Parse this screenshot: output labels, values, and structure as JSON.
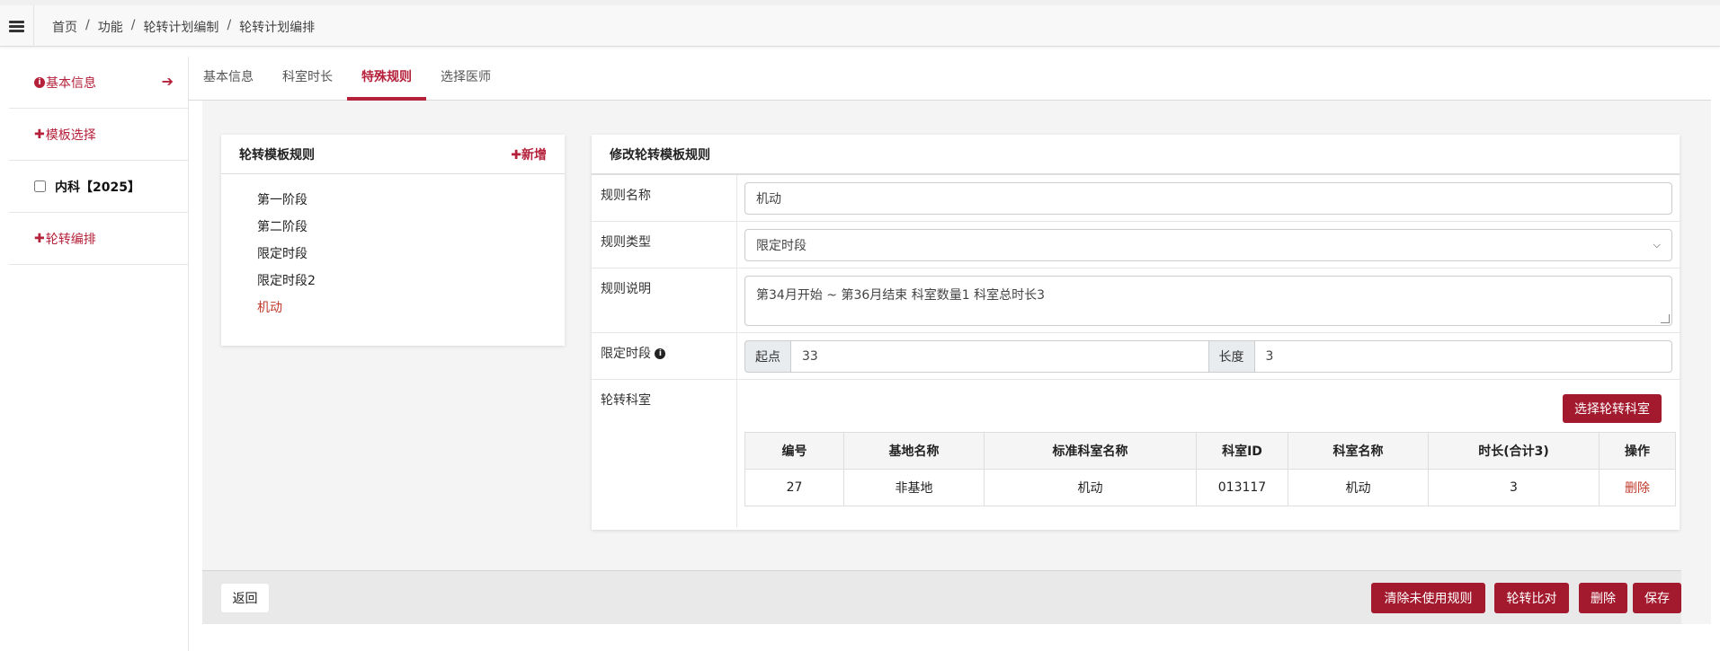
{
  "header": {
    "breadcrumb": [
      "首页",
      "功能",
      "轮转计划编制",
      "轮转计划编排"
    ]
  },
  "sidebar": {
    "items": [
      {
        "icon": "info-circle",
        "label": "基本信息",
        "arrow": "➔"
      },
      {
        "icon": "plus",
        "label": "模板选择"
      },
      {
        "icon": "checkbox",
        "label": "内科【2025】",
        "checked": false
      },
      {
        "icon": "plus",
        "label": "轮转编排"
      }
    ]
  },
  "tabs": [
    {
      "label": "基本信息",
      "active": false
    },
    {
      "label": "科室时长",
      "active": false
    },
    {
      "label": "特殊规则",
      "active": true
    },
    {
      "label": "选择医师",
      "active": false
    }
  ],
  "rules_panel": {
    "title": "轮转模板规则",
    "add_label": "✚新增",
    "items": [
      "第一阶段",
      "第二阶段",
      "限定时段",
      "限定时段2",
      "机动"
    ],
    "active_item": "机动"
  },
  "edit_panel": {
    "title": "修改轮转模板规则",
    "fields": {
      "name_label": "规则名称",
      "name_value": "机动",
      "type_label": "规则类型",
      "type_value": "限定时段",
      "desc_label": "规则说明",
      "desc_value": "第34月开始 ~ 第36月结束 科室数量1 科室总时长3",
      "period_label": "限定时段",
      "start_label": "起点",
      "start_value": "33",
      "length_label": "长度",
      "length_value": "3",
      "dept_label": "轮转科室"
    },
    "select_dept_button": "选择轮转科室",
    "table": {
      "headers": [
        "编号",
        "基地名称",
        "标准科室名称",
        "科室ID",
        "科室名称",
        "时长(合计3)",
        "操作"
      ],
      "rows": [
        {
          "id": "27",
          "base": "非基地",
          "std_dept": "机动",
          "dept_id": "013117",
          "dept_name": "机动",
          "duration": "3",
          "action": "删除"
        }
      ]
    }
  },
  "footer": {
    "back": "返回",
    "clear_unused": "清除未使用规则",
    "compare": "轮转比对",
    "delete": "删除",
    "save": "保存"
  },
  "colors": {
    "accent": "#b5213a",
    "button": "#a31a2e"
  }
}
